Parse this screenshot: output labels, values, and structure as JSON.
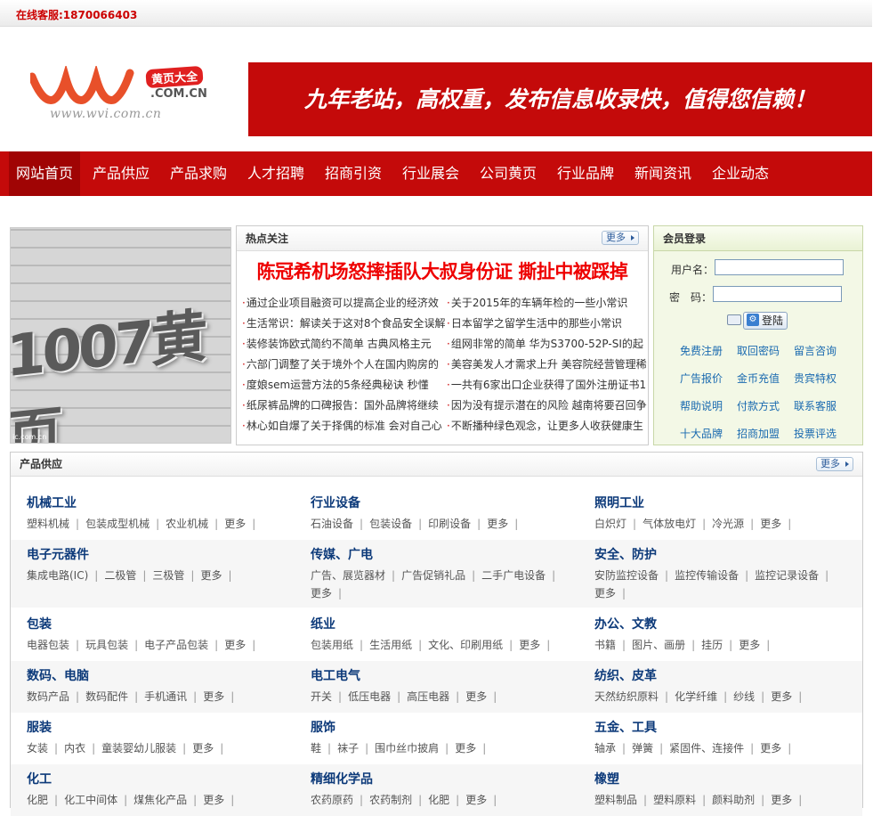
{
  "topbar": {
    "service": "在线客服:1870066403"
  },
  "logo": {
    "badge": "黄页大全",
    "domain": ".COM.CN",
    "url_text": "www.wvi.com.cn"
  },
  "banner": {
    "slogan": "九年老站，高权重，发布信息收录快，值得您信赖！"
  },
  "nav": [
    "网站首页",
    "产品供应",
    "产品求购",
    "人才招聘",
    "招商引资",
    "行业展会",
    "公司黄页",
    "行业品牌",
    "新闻资讯",
    "企业动态"
  ],
  "photo": {
    "caption": "ic.com.cn"
  },
  "hot": {
    "title": "热点关注",
    "more": "更多",
    "headline": "陈冠希机场怒摔插队大叔身份证 撕扯中被踩掉",
    "left": [
      "通过企业项目融资可以提高企业的经济效",
      "生活常识：解读关于这对8个食品安全误解",
      "装修装饰欧式简约不简单 古典风格主元",
      "六部门调整了关于境外个人在国内购房的",
      "度娘sem运营方法的5条经典秘诀 秒懂",
      "纸尿裤品牌的口碑报告：国外品牌将继续",
      "林心如自爆了关于择偶的标准 会对自己心"
    ],
    "right": [
      "关于2015年的车辆年检的一些小常识",
      "日本留学之留学生活中的那些小常识",
      "组网非常的简单 华为S3700-52P-SI的起",
      "美容美发人才需求上升 美容院经营管理稀",
      "一共有6家出口企业获得了国外注册证书1",
      "因为没有提示潜在的风险 越南将要召回争",
      "不断播种绿色观念，让更多人收获健康生"
    ]
  },
  "login": {
    "title": "会员登录",
    "username_label": "用户名：",
    "password_label": "密　码：",
    "button": "登陆",
    "links": [
      "免费注册",
      "取回密码",
      "留言咨询",
      "广告报价",
      "金币充值",
      "贵宾特权",
      "帮助说明",
      "付款方式",
      "联系客服",
      "十大品牌",
      "招商加盟",
      "投票评选"
    ]
  },
  "supply": {
    "title": "产品供应",
    "more": "更多",
    "rows": [
      [
        {
          "title": "机械工业",
          "subs": [
            "塑料机械",
            "包装成型机械",
            "农业机械",
            "更多"
          ]
        },
        {
          "title": "行业设备",
          "subs": [
            "石油设备",
            "包装设备",
            "印刷设备",
            "更多"
          ]
        },
        {
          "title": "照明工业",
          "subs": [
            "白炽灯",
            "气体放电灯",
            "冷光源",
            "更多"
          ]
        }
      ],
      [
        {
          "title": "电子元器件",
          "subs": [
            "集成电路(IC)",
            "二极管",
            "三极管",
            "更多"
          ]
        },
        {
          "title": "传媒、广电",
          "subs": [
            "广告、展览器材",
            "广告促销礼品",
            "二手广电设备",
            "更多"
          ]
        },
        {
          "title": "安全、防护",
          "subs": [
            "安防监控设备",
            "监控传输设备",
            "监控记录设备",
            "更多"
          ]
        }
      ],
      [
        {
          "title": "包装",
          "subs": [
            "电器包装",
            "玩具包装",
            "电子产品包装",
            "更多"
          ]
        },
        {
          "title": "纸业",
          "subs": [
            "包装用纸",
            "生活用纸",
            "文化、印刷用纸",
            "更多"
          ]
        },
        {
          "title": "办公、文教",
          "subs": [
            "书籍",
            "图片、画册",
            "挂历",
            "更多"
          ]
        }
      ],
      [
        {
          "title": "数码、电脑",
          "subs": [
            "数码产品",
            "数码配件",
            "手机通讯",
            "更多"
          ]
        },
        {
          "title": "电工电气",
          "subs": [
            "开关",
            "低压电器",
            "高压电器",
            "更多"
          ]
        },
        {
          "title": "纺织、皮革",
          "subs": [
            "天然纺织原料",
            "化学纤维",
            "纱线",
            "更多"
          ]
        }
      ],
      [
        {
          "title": "服装",
          "subs": [
            "女装",
            "内衣",
            "童装婴幼儿服装",
            "更多"
          ]
        },
        {
          "title": "服饰",
          "subs": [
            "鞋",
            "袜子",
            "围巾丝巾披肩",
            "更多"
          ]
        },
        {
          "title": "五金、工具",
          "subs": [
            "轴承",
            "弹簧",
            "紧固件、连接件",
            "更多"
          ]
        }
      ],
      [
        {
          "title": "化工",
          "subs": [
            "化肥",
            "化工中间体",
            "煤焦化产品",
            "更多"
          ]
        },
        {
          "title": "精细化学品",
          "subs": [
            "农药原药",
            "农药制剂",
            "化肥",
            "更多"
          ]
        },
        {
          "title": "橡塑",
          "subs": [
            "塑料制品",
            "塑料原料",
            "颜料助剂",
            "更多"
          ]
        }
      ]
    ]
  }
}
